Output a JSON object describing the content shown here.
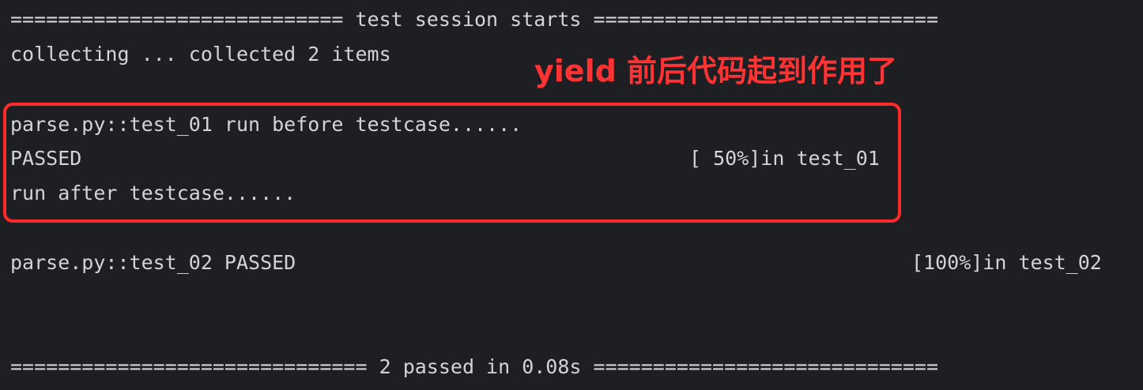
{
  "terminal": {
    "session_header": "============================ test session starts =============================",
    "collecting": "collecting ... collected 2 items",
    "annotation": "yield 前后代码起到作用了",
    "test01_line": "parse.py::test_01 run before testcase......",
    "test01_status": "PASSED",
    "test01_progress": "[ 50%]in test_01",
    "test01_after": "run after testcase......",
    "test02_line": "parse.py::test_02 PASSED",
    "test02_progress": "[100%]in test_02",
    "summary": "============================== 2 passed in 0.08s ============================="
  },
  "colors": {
    "background": "#1e1f22",
    "text": "#d2d4da",
    "highlight": "#ff2b2b"
  }
}
